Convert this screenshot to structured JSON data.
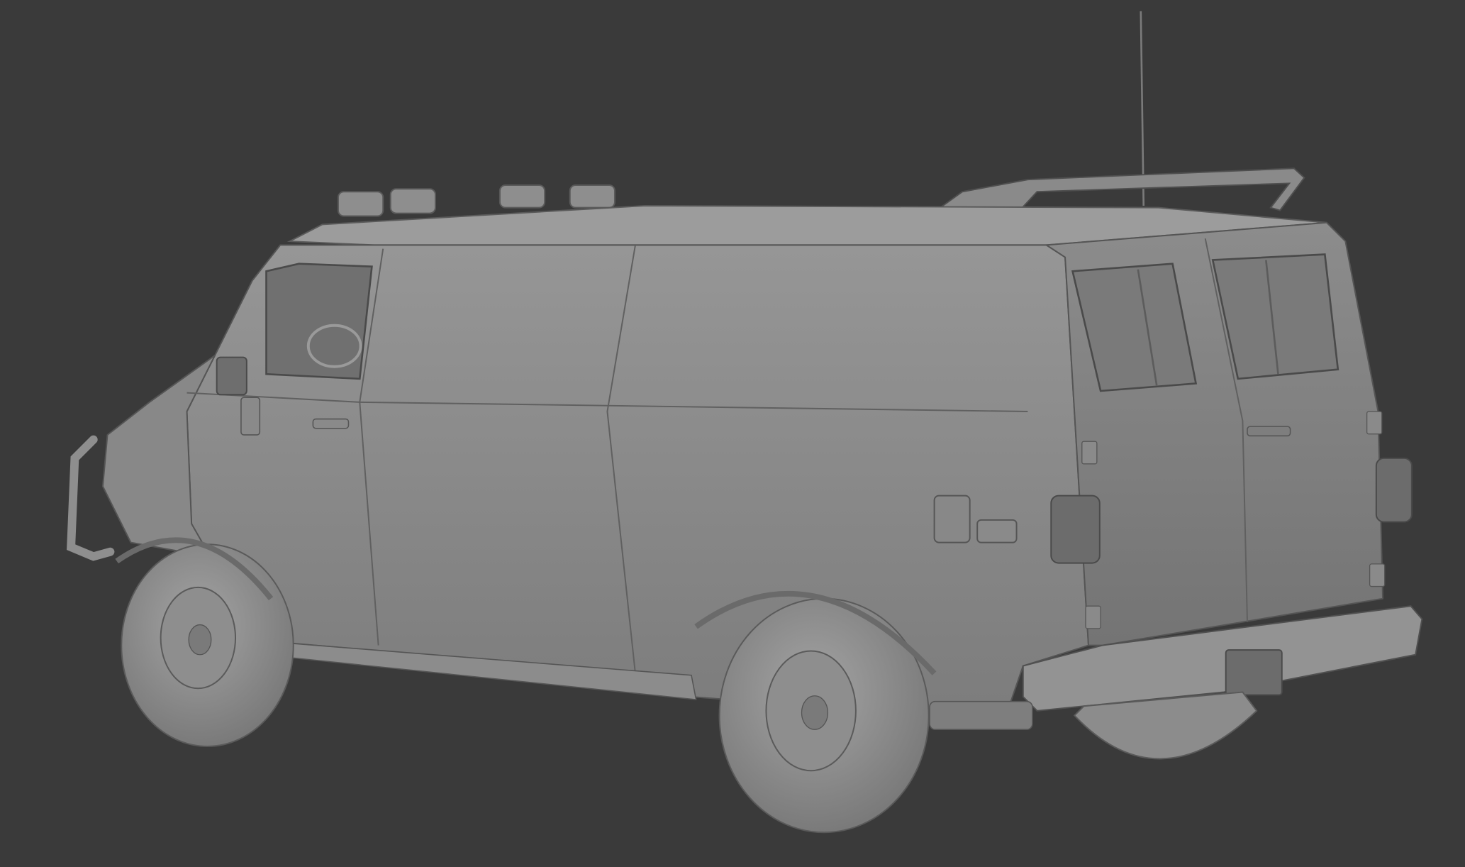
{
  "scene": {
    "subject": "van-model",
    "background_color": "#3a3a3a",
    "model_color": "#8a8a8a",
    "shading": "solid-matcap-grey"
  }
}
